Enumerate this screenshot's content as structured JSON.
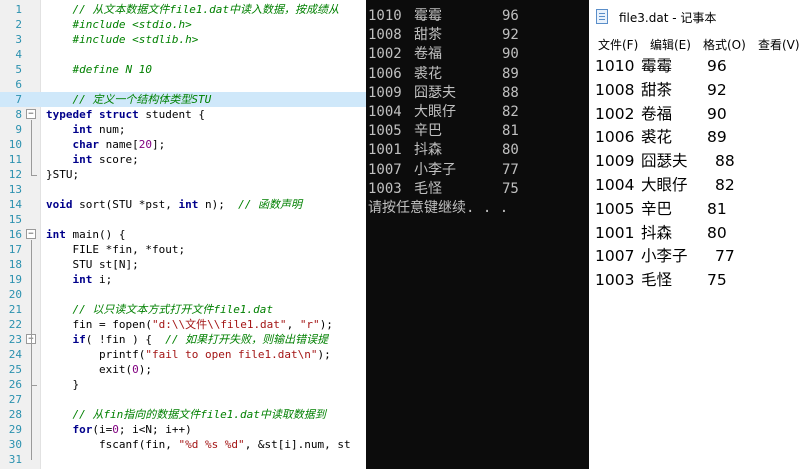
{
  "editor": {
    "lines": [
      {
        "n": "1",
        "fold": "",
        "hl": false,
        "tokens": [
          {
            "t": "    // 从文本数据文件file1.dat中读入数据，按成绩从",
            "c": "c"
          }
        ]
      },
      {
        "n": "2",
        "fold": "",
        "hl": false,
        "tokens": [
          {
            "t": "    #include <stdio.h>",
            "c": "c"
          }
        ]
      },
      {
        "n": "3",
        "fold": "",
        "hl": false,
        "tokens": [
          {
            "t": "    #include <stdlib.h>",
            "c": "c"
          }
        ]
      },
      {
        "n": "4",
        "fold": "",
        "hl": false,
        "tokens": []
      },
      {
        "n": "5",
        "fold": "",
        "hl": false,
        "tokens": [
          {
            "t": "    #define N 10",
            "c": "c"
          }
        ]
      },
      {
        "n": "6",
        "fold": "",
        "hl": false,
        "tokens": []
      },
      {
        "n": "7",
        "fold": "",
        "hl": true,
        "tokens": [
          {
            "t": "    // 定义一个结构体类型STU",
            "c": "c"
          }
        ]
      },
      {
        "n": "8",
        "fold": "−",
        "hl": false,
        "tokens": [
          {
            "t": "typedef struct ",
            "c": "k"
          },
          {
            "t": "student {",
            "c": "n"
          }
        ]
      },
      {
        "n": "9",
        "fold": "",
        "hl": false,
        "tokens": [
          {
            "t": "    int ",
            "c": "k"
          },
          {
            "t": "num;",
            "c": "n"
          }
        ]
      },
      {
        "n": "10",
        "fold": "",
        "hl": false,
        "tokens": [
          {
            "t": "    char ",
            "c": "k"
          },
          {
            "t": "name[",
            "c": "n"
          },
          {
            "t": "20",
            "c": "num"
          },
          {
            "t": "];",
            "c": "n"
          }
        ]
      },
      {
        "n": "11",
        "fold": "",
        "hl": false,
        "tokens": [
          {
            "t": "    int ",
            "c": "k"
          },
          {
            "t": "score;",
            "c": "n"
          }
        ]
      },
      {
        "n": "12",
        "fold": "",
        "hl": false,
        "tokens": [
          {
            "t": "}STU;",
            "c": "n"
          }
        ]
      },
      {
        "n": "13",
        "fold": "",
        "hl": false,
        "tokens": []
      },
      {
        "n": "14",
        "fold": "",
        "hl": false,
        "tokens": [
          {
            "t": "void ",
            "c": "k"
          },
          {
            "t": "sort(STU *pst, ",
            "c": "n"
          },
          {
            "t": "int ",
            "c": "k"
          },
          {
            "t": "n);  ",
            "c": "n"
          },
          {
            "t": "// 函数声明",
            "c": "c"
          }
        ]
      },
      {
        "n": "15",
        "fold": "",
        "hl": false,
        "tokens": []
      },
      {
        "n": "16",
        "fold": "−",
        "hl": false,
        "tokens": [
          {
            "t": "int ",
            "c": "k"
          },
          {
            "t": "main() {",
            "c": "n"
          }
        ]
      },
      {
        "n": "17",
        "fold": "",
        "hl": false,
        "tokens": [
          {
            "t": "    FILE *fin, *fout;",
            "c": "n"
          }
        ]
      },
      {
        "n": "18",
        "fold": "",
        "hl": false,
        "tokens": [
          {
            "t": "    STU st[N];",
            "c": "n"
          }
        ]
      },
      {
        "n": "19",
        "fold": "",
        "hl": false,
        "tokens": [
          {
            "t": "    int ",
            "c": "k"
          },
          {
            "t": "i;",
            "c": "n"
          }
        ]
      },
      {
        "n": "20",
        "fold": "",
        "hl": false,
        "tokens": []
      },
      {
        "n": "21",
        "fold": "",
        "hl": false,
        "tokens": [
          {
            "t": "    // 以只读文本方式打开文件file1.dat",
            "c": "c"
          }
        ]
      },
      {
        "n": "22",
        "fold": "",
        "hl": false,
        "tokens": [
          {
            "t": "    fin = fopen(",
            "c": "n"
          },
          {
            "t": "\"d:\\\\文件\\\\file1.dat\"",
            "c": "s"
          },
          {
            "t": ", ",
            "c": "n"
          },
          {
            "t": "\"r\"",
            "c": "s"
          },
          {
            "t": ");",
            "c": "n"
          }
        ]
      },
      {
        "n": "23",
        "fold": "−",
        "hl": false,
        "tokens": [
          {
            "t": "    if",
            "c": "k"
          },
          {
            "t": "( !fin ) {  ",
            "c": "n"
          },
          {
            "t": "// 如果打开失败，则输出错误提",
            "c": "c"
          }
        ]
      },
      {
        "n": "24",
        "fold": "",
        "hl": false,
        "tokens": [
          {
            "t": "        printf(",
            "c": "n"
          },
          {
            "t": "\"fail to open file1.dat\\n\"",
            "c": "s"
          },
          {
            "t": ");",
            "c": "n"
          }
        ]
      },
      {
        "n": "25",
        "fold": "",
        "hl": false,
        "tokens": [
          {
            "t": "        exit(",
            "c": "n"
          },
          {
            "t": "0",
            "c": "num"
          },
          {
            "t": ");",
            "c": "n"
          }
        ]
      },
      {
        "n": "26",
        "fold": "",
        "hl": false,
        "tokens": [
          {
            "t": "    }",
            "c": "n"
          }
        ]
      },
      {
        "n": "27",
        "fold": "",
        "hl": false,
        "tokens": []
      },
      {
        "n": "28",
        "fold": "",
        "hl": false,
        "tokens": [
          {
            "t": "    // 从fin指向的数据文件file1.dat中读取数据到",
            "c": "c"
          }
        ]
      },
      {
        "n": "29",
        "fold": "",
        "hl": false,
        "tokens": [
          {
            "t": "    for",
            "c": "k"
          },
          {
            "t": "(i=",
            "c": "n"
          },
          {
            "t": "0",
            "c": "num"
          },
          {
            "t": "; i<N; i++)",
            "c": "n"
          }
        ]
      },
      {
        "n": "30",
        "fold": "",
        "hl": false,
        "tokens": [
          {
            "t": "        fscanf(fin, ",
            "c": "n"
          },
          {
            "t": "\"%d %s %d\"",
            "c": "s"
          },
          {
            "t": ", &st[i].num, st",
            "c": "n"
          }
        ]
      },
      {
        "n": "31",
        "fold": "",
        "hl": false,
        "tokens": []
      }
    ]
  },
  "console": {
    "rows": [
      {
        "num": "1010",
        "name": "霉霉",
        "score": "96"
      },
      {
        "num": "1008",
        "name": "甜茶",
        "score": "92"
      },
      {
        "num": "1002",
        "name": "卷福",
        "score": "90"
      },
      {
        "num": "1006",
        "name": "裘花",
        "score": "89"
      },
      {
        "num": "1009",
        "name": "囧瑟夫",
        "score": "88"
      },
      {
        "num": "1004",
        "name": "大眼仔",
        "score": "82"
      },
      {
        "num": "1005",
        "name": "辛巴",
        "score": "81"
      },
      {
        "num": "1001",
        "name": "抖森",
        "score": "80"
      },
      {
        "num": "1007",
        "name": "小李子",
        "score": "77"
      },
      {
        "num": "1003",
        "name": "毛怪",
        "score": "75"
      }
    ],
    "prompt": "请按任意键继续. . ."
  },
  "notepad": {
    "title": "file3.dat - 记事本",
    "menu": [
      "文件(F)",
      "编辑(E)",
      "格式(O)",
      "查看(V)"
    ],
    "rows": [
      {
        "num": "1010",
        "name": "霉霉",
        "score": "96"
      },
      {
        "num": "1008",
        "name": "甜茶",
        "score": "92"
      },
      {
        "num": "1002",
        "name": "卷福",
        "score": "90"
      },
      {
        "num": "1006",
        "name": "裘花",
        "score": "89"
      },
      {
        "num": "1009",
        "name": "囧瑟夫",
        "score": "88"
      },
      {
        "num": "1004",
        "name": "大眼仔",
        "score": "82"
      },
      {
        "num": "1005",
        "name": "辛巴",
        "score": "81"
      },
      {
        "num": "1001",
        "name": "抖森",
        "score": "80"
      },
      {
        "num": "1007",
        "name": "小李子",
        "score": "77"
      },
      {
        "num": "1003",
        "name": "毛怪",
        "score": "75"
      }
    ]
  }
}
